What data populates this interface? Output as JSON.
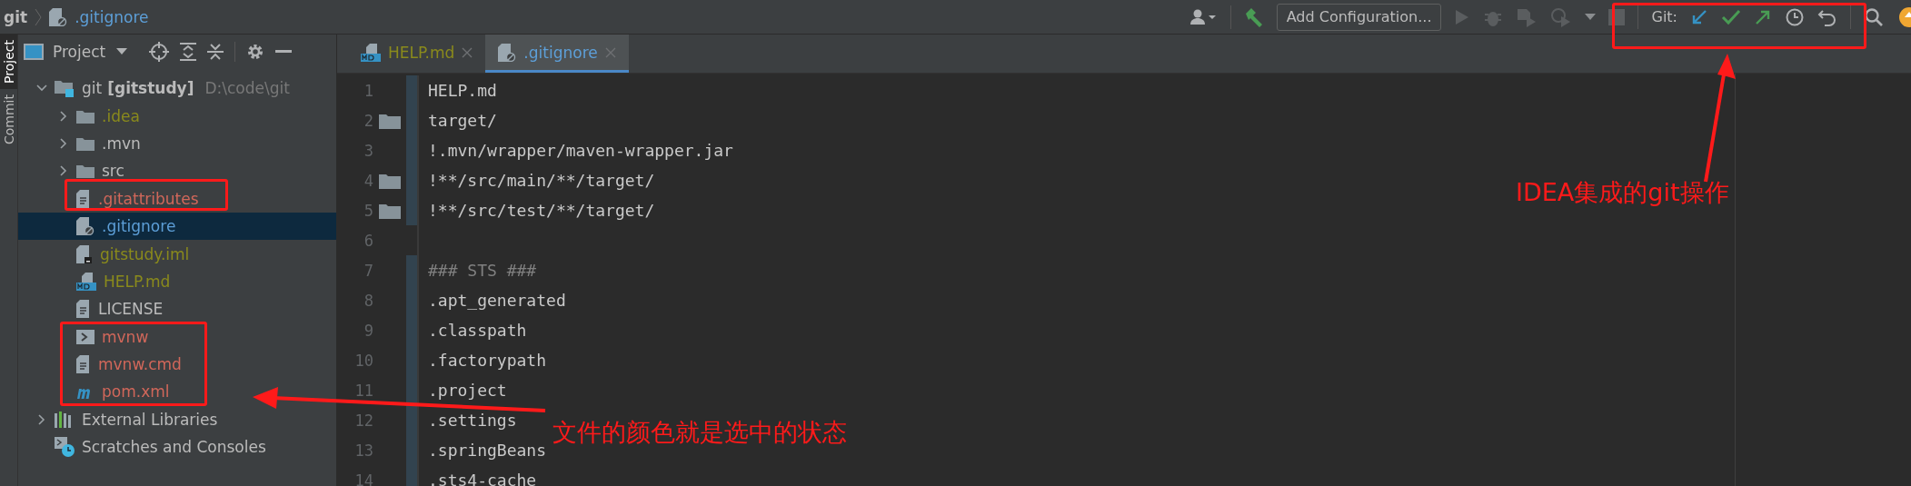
{
  "breadcrumb": {
    "project": "git",
    "file": ".gitignore",
    "color": "#5d9fd8"
  },
  "toolbar": {
    "run_config": "Add Configuration...",
    "git_label": "Git:"
  },
  "side_tabs": [
    {
      "label": "Project",
      "selected": true
    },
    {
      "label": "Commit",
      "selected": false
    }
  ],
  "project_panel": {
    "title": "Project",
    "tree": [
      {
        "name": "git",
        "module": "[gitstudy]",
        "path": "D:\\code\\git",
        "kind": "module",
        "color": "#bbbbbb",
        "expanded": true,
        "selected": false,
        "children": [
          {
            "name": ".idea",
            "kind": "folder",
            "color": "#8a8a1c",
            "expanded": false,
            "selected": false
          },
          {
            "name": ".mvn",
            "kind": "folder",
            "color": "#bbbbbb",
            "expanded": false,
            "selected": false
          },
          {
            "name": "src",
            "kind": "folder",
            "color": "#bbbbbb",
            "expanded": false,
            "selected": false
          },
          {
            "name": ".gitattributes",
            "kind": "text",
            "color": "#d1675a",
            "selected": false
          },
          {
            "name": ".gitignore",
            "kind": "ignore",
            "color": "#5d9fd8",
            "selected": true
          },
          {
            "name": "gitstudy.iml",
            "kind": "iml",
            "color": "#8a8a1c",
            "selected": false
          },
          {
            "name": "HELP.md",
            "kind": "md",
            "color": "#8a8a1c",
            "selected": false
          },
          {
            "name": "LICENSE",
            "kind": "text",
            "color": "#bbbbbb",
            "selected": false
          },
          {
            "name": "mvnw",
            "kind": "shell",
            "color": "#d1675a",
            "selected": false
          },
          {
            "name": "mvnw.cmd",
            "kind": "text",
            "color": "#d1675a",
            "selected": false
          },
          {
            "name": "pom.xml",
            "kind": "maven",
            "color": "#d1675a",
            "selected": false
          }
        ]
      },
      {
        "name": "External Libraries",
        "kind": "libraries",
        "color": "#bbbbbb",
        "expanded": false,
        "selected": false
      },
      {
        "name": "Scratches and Consoles",
        "kind": "scratches",
        "color": "#bbbbbb",
        "selected": false
      }
    ]
  },
  "editor_tabs": [
    {
      "label": "HELP.md",
      "kind": "md",
      "color": "#8a8a1c",
      "selected": false
    },
    {
      "label": ".gitignore",
      "kind": "ignore",
      "color": "#5d9fd8",
      "selected": true
    }
  ],
  "editor_lines": [
    {
      "number": "1",
      "text": "HELP.md",
      "kind": "pattern",
      "folder": false
    },
    {
      "number": "2",
      "text": "target/",
      "kind": "pattern",
      "folder": true
    },
    {
      "number": "3",
      "text": "!.mvn/wrapper/maven-wrapper.jar",
      "kind": "pattern",
      "folder": false
    },
    {
      "number": "4",
      "text": "!**/src/main/**/target/",
      "kind": "pattern",
      "folder": true
    },
    {
      "number": "5",
      "text": "!**/src/test/**/target/",
      "kind": "pattern",
      "folder": true
    },
    {
      "number": "6",
      "kind": "blank",
      "folder": false
    },
    {
      "number": "7",
      "text": "### STS ###",
      "kind": "comment",
      "folder": false
    },
    {
      "number": "8",
      "text": ".apt_generated",
      "kind": "pattern",
      "folder": false
    },
    {
      "number": "9",
      "text": ".classpath",
      "kind": "pattern",
      "folder": false
    },
    {
      "number": "10",
      "text": ".factorypath",
      "kind": "pattern",
      "folder": false
    },
    {
      "number": "11",
      "text": ".project",
      "kind": "pattern",
      "folder": false
    },
    {
      "number": "12",
      "text": ".settings",
      "kind": "pattern",
      "folder": false
    },
    {
      "number": "13",
      "text": ".springBeans",
      "kind": "pattern",
      "folder": false
    },
    {
      "number": "14",
      "text": ".sts4-cache",
      "kind": "pattern",
      "folder": false
    }
  ],
  "annotations": [
    {
      "text": "IDEA集成的git操作"
    },
    {
      "text": "文件的颜色就是选中的状态"
    }
  ]
}
